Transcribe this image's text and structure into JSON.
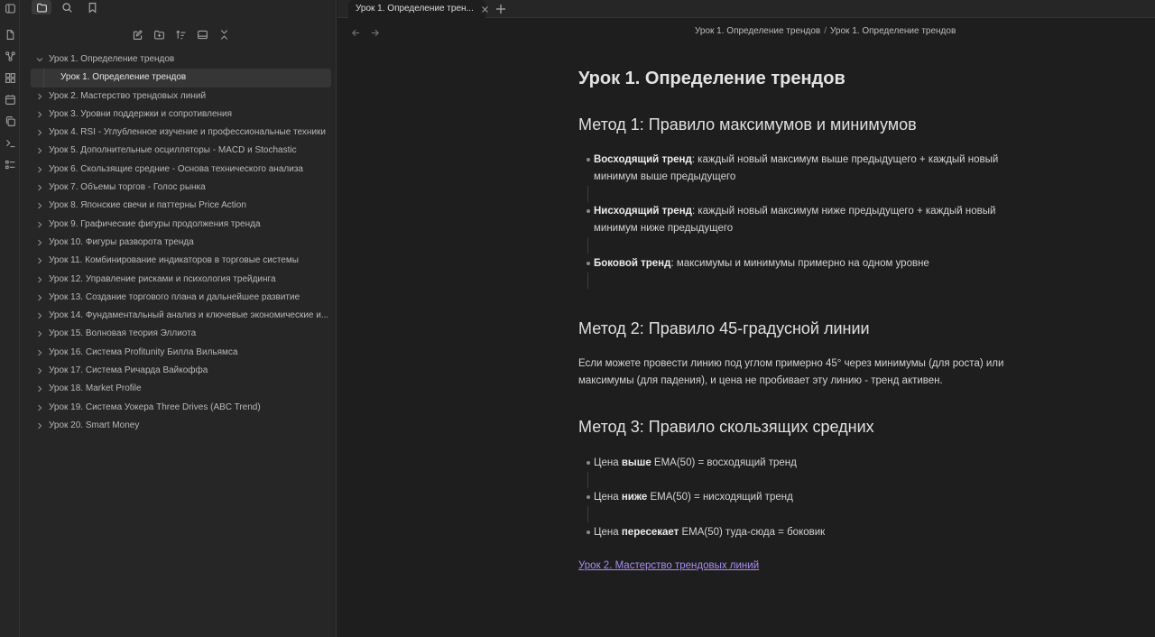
{
  "tab": {
    "title": "Урок 1. Определение трен..."
  },
  "breadcrumb": {
    "folder": "Урок 1. Определение трендов",
    "separator": "/",
    "file": "Урок 1. Определение трендов"
  },
  "sidebar": {
    "items": [
      {
        "label": "Урок 1. Определение трендов",
        "expanded": true
      },
      {
        "label": "Урок 1. Определение трендов",
        "child": true,
        "active": true
      },
      {
        "label": "Урок 2. Мастерство трендовых линий"
      },
      {
        "label": "Урок 3. Уровни поддержки и сопротивления"
      },
      {
        "label": "Урок 4. RSI - Углубленное изучение и  профессиональные техники"
      },
      {
        "label": "Урок 5. Дополнительные осцилляторы - MACD  и Stochastic"
      },
      {
        "label": "Урок 6. Скользящие средние - Основа технического анализа"
      },
      {
        "label": "Урок 7. Объемы торгов - Голос рынка"
      },
      {
        "label": "Урок 8. Японские свечи и паттерны Price Action"
      },
      {
        "label": "Урок 9. Графические фигуры продолжения тренда"
      },
      {
        "label": "Урок 10. Фигуры разворота тренда"
      },
      {
        "label": "Урок 11. Комбинирование индикаторов в торговые системы"
      },
      {
        "label": "Урок 12. Управление рисками и психология трейдинга"
      },
      {
        "label": "Урок 13. Создание торгового плана и дальнейшее развитие"
      },
      {
        "label": "Урок 14. Фундаментальный анализ и ключевые экономические и..."
      },
      {
        "label": "Урок 15. Волновая теория Эллиота"
      },
      {
        "label": "Урок 16. Система Profitunity Билла Вильямса"
      },
      {
        "label": "Урок 17. Система Ричарда Вайкоффа"
      },
      {
        "label": "Урок 18. Market Profile"
      },
      {
        "label": "Урок 19. Система Уокера Three Drives (ABC Trend)"
      },
      {
        "label": "Урок 20. Smart Money"
      }
    ]
  },
  "note": {
    "title": "Урок 1. Определение трендов",
    "method1": {
      "heading": "Метод 1: Правило максимумов и минимумов",
      "b1_strong": "Восходящий тренд",
      "b1_text": ": каждый новый максимум выше предыдущего + каждый новый минимум выше предыдущего",
      "b2_strong": "Нисходящий тренд",
      "b2_text": ": каждый новый максимум ниже предыдущего + каждый новый минимум ниже предыдущего",
      "b3_strong": "Боковой тренд",
      "b3_text": ": максимумы и минимумы примерно на одном уровне"
    },
    "method2": {
      "heading": "Метод 2: Правило 45-градусной линии",
      "text": "Если можете провести линию под углом примерно 45° через минимумы (для роста) или максимумы (для падения), и цена не пробивает эту линию - тренд активен."
    },
    "method3": {
      "heading": "Метод 3: Правило скользящих средних",
      "b1_pre": "Цена ",
      "b1_strong": "выше",
      "b1_post": " EMA(50) = восходящий тренд",
      "b2_pre": "Цена ",
      "b2_strong": "ниже",
      "b2_post": " EMA(50) = нисходящий тренд",
      "b3_pre": "Цена ",
      "b3_strong": "пересекает",
      "b3_post": " EMA(50) туда-сюда = боковик"
    },
    "next_link": "Урок 2. Мастерство трендовых линий"
  },
  "icons": {
    "ribbon": [
      "sidebar-toggle-icon",
      "file-open-icon",
      "graph-icon",
      "canvas-icon",
      "calendar-icon",
      "copy-icon",
      "terminal-icon",
      "list-icon"
    ],
    "sidebar_tabs": [
      "folder-icon",
      "search-icon",
      "bookmark-icon"
    ],
    "sidebar_actions": [
      "new-note-icon",
      "new-folder-icon",
      "sort-icon",
      "collapse-panel-icon",
      "collapse-all-icon"
    ]
  },
  "colors": {
    "background": "#1e1e1e",
    "sidebar": "#262626",
    "link": "#a98cf0",
    "active_item": "#363636"
  }
}
